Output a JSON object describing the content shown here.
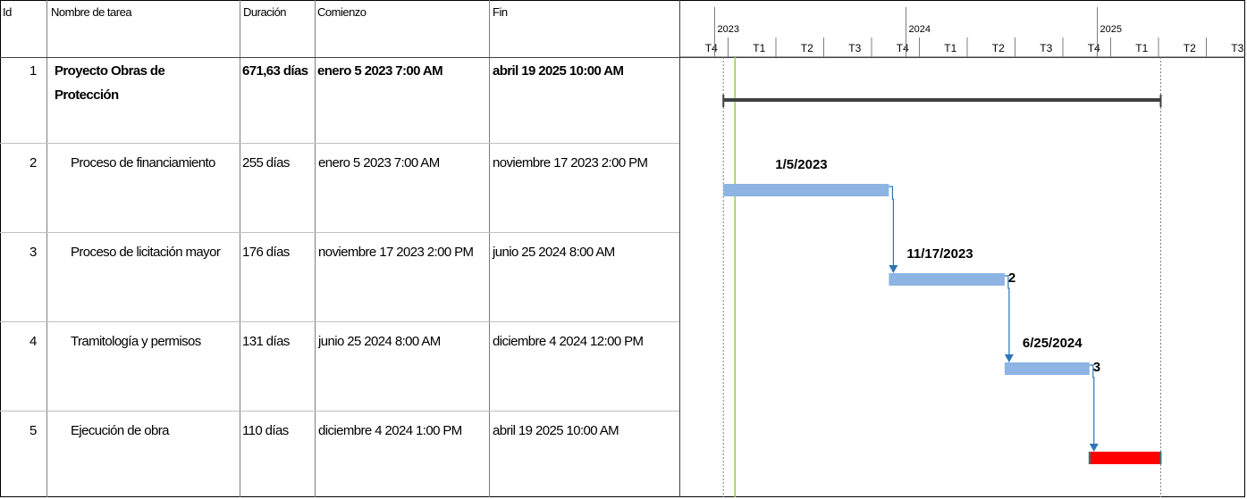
{
  "table": {
    "headers": {
      "id": "Id",
      "name": "Nombre de tarea",
      "duration": "Duración",
      "start": "Comienzo",
      "finish": "Fin"
    },
    "rows": [
      {
        "id": "1",
        "name": "Proyecto Obras de Protección",
        "duration": "671,63 días",
        "start": "enero 5 2023 7:00 AM",
        "finish": "abril 19 2025 10:00 AM",
        "summary": true
      },
      {
        "id": "2",
        "name": "Proceso de financiamiento",
        "duration": "255 días",
        "start": "enero 5 2023 7:00 AM",
        "finish": "noviembre 17 2023 2:00 PM",
        "summary": false
      },
      {
        "id": "3",
        "name": "Proceso de licitación mayor",
        "duration": "176 días",
        "start": "noviembre 17 2023 2:00 PM",
        "finish": "junio 25 2024 8:00 AM",
        "summary": false
      },
      {
        "id": "4",
        "name": "Tramitología y permisos",
        "duration": "131 días",
        "start": "junio 25 2024 8:00 AM",
        "finish": "diciembre 4 2024 12:00 PM",
        "summary": false
      },
      {
        "id": "5",
        "name": "Ejecución de obra",
        "duration": "110 días",
        "start": "diciembre 4 2024 1:00 PM",
        "finish": "abril 19 2025 10:00 AM",
        "summary": false
      }
    ]
  },
  "chart_data": {
    "type": "gantt",
    "timescale": {
      "years": [
        "2023",
        "2024",
        "2025"
      ],
      "quarters": [
        "T4",
        "T1",
        "T2",
        "T3",
        "T4",
        "T1",
        "T2",
        "T3",
        "T4",
        "T1",
        "T2",
        "T3"
      ]
    },
    "tasks": [
      {
        "id": "1",
        "start": "2023-01-05",
        "finish": "2025-04-19",
        "kind": "summary",
        "start_label": "",
        "end_label": ""
      },
      {
        "id": "2",
        "start": "2023-01-05",
        "finish": "2023-11-17",
        "kind": "task",
        "start_label": "1/5/2023",
        "end_label": ""
      },
      {
        "id": "3",
        "start": "2023-11-17",
        "finish": "2024-06-25",
        "kind": "task",
        "start_label": "11/17/2023",
        "end_label": "2"
      },
      {
        "id": "4",
        "start": "2024-06-25",
        "finish": "2024-12-04",
        "kind": "task",
        "start_label": "6/25/2024",
        "end_label": "3"
      },
      {
        "id": "5",
        "start": "2024-12-04",
        "finish": "2025-04-19",
        "kind": "critical",
        "start_label": "",
        "end_label": ""
      }
    ],
    "colors": {
      "task_bar": "#8db4e2",
      "critical_bar": "#ff0000",
      "summary_bar": "#404040",
      "link": "#2e75b6",
      "today_line": "#92d050"
    }
  }
}
